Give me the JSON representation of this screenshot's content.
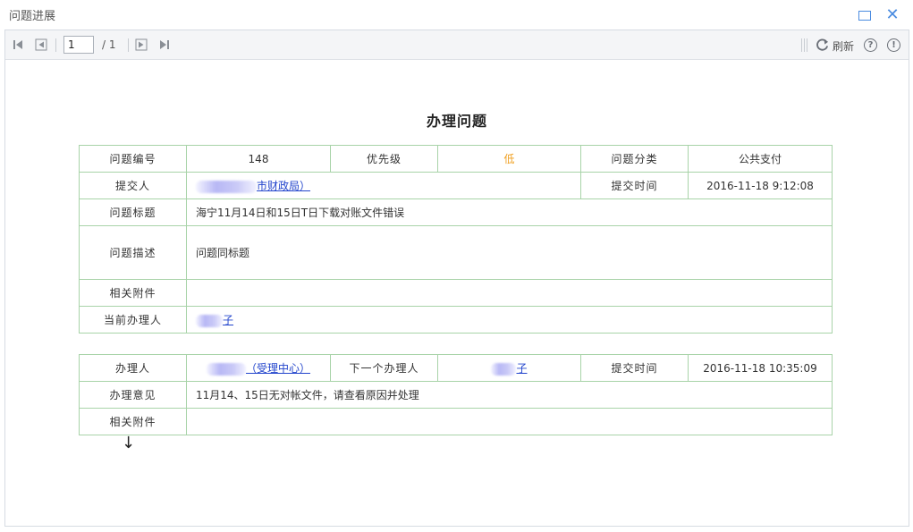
{
  "window": {
    "title": "问题进展"
  },
  "toolbar": {
    "page_value": "1",
    "page_total": "/ 1",
    "refresh_label": "刷新",
    "help_glyph": "?",
    "info_glyph": "!"
  },
  "report": {
    "title": "办理问题",
    "issue": {
      "labels": {
        "id": "问题编号",
        "priority": "优先级",
        "category": "问题分类",
        "submitter": "提交人",
        "submit_time": "提交时间",
        "subject": "问题标题",
        "description": "问题描述",
        "attachments": "相关附件",
        "handler": "当前办理人"
      },
      "values": {
        "id": "148",
        "priority": "低",
        "category": "公共支付",
        "submitter": "市财政局）",
        "submit_time": "2016-11-18 9:12:08",
        "subject": "海宁11月14日和15日T日下载对账文件错误",
        "description": "问题同标题",
        "attachments": "",
        "handler": "子"
      }
    },
    "progress": {
      "labels": {
        "processor": "办理人",
        "next_processor": "下一个办理人",
        "submit_time": "提交时间",
        "opinion": "办理意见",
        "attachments": "相关附件"
      },
      "values": {
        "processor": "（受理中心）",
        "next_processor": "子",
        "submit_time": "2016-11-18 10:35:09",
        "opinion": "11月14、15日无对帐文件，请查看原因并处理",
        "attachments": ""
      }
    },
    "arrow": "↓"
  },
  "colors": {
    "grid_border": "#a8d3a8",
    "link": "#2244cc",
    "priority_low": "#f0a020",
    "window_accent": "#4a8be0"
  },
  "icons": {
    "first_page": "first-page-icon",
    "prev_page": "prev-page-icon",
    "next_page": "next-page-icon",
    "last_page": "last-page-icon",
    "refresh": "refresh-icon",
    "help": "help-icon",
    "info": "info-icon",
    "maximize": "maximize-icon",
    "close": "close-icon"
  }
}
